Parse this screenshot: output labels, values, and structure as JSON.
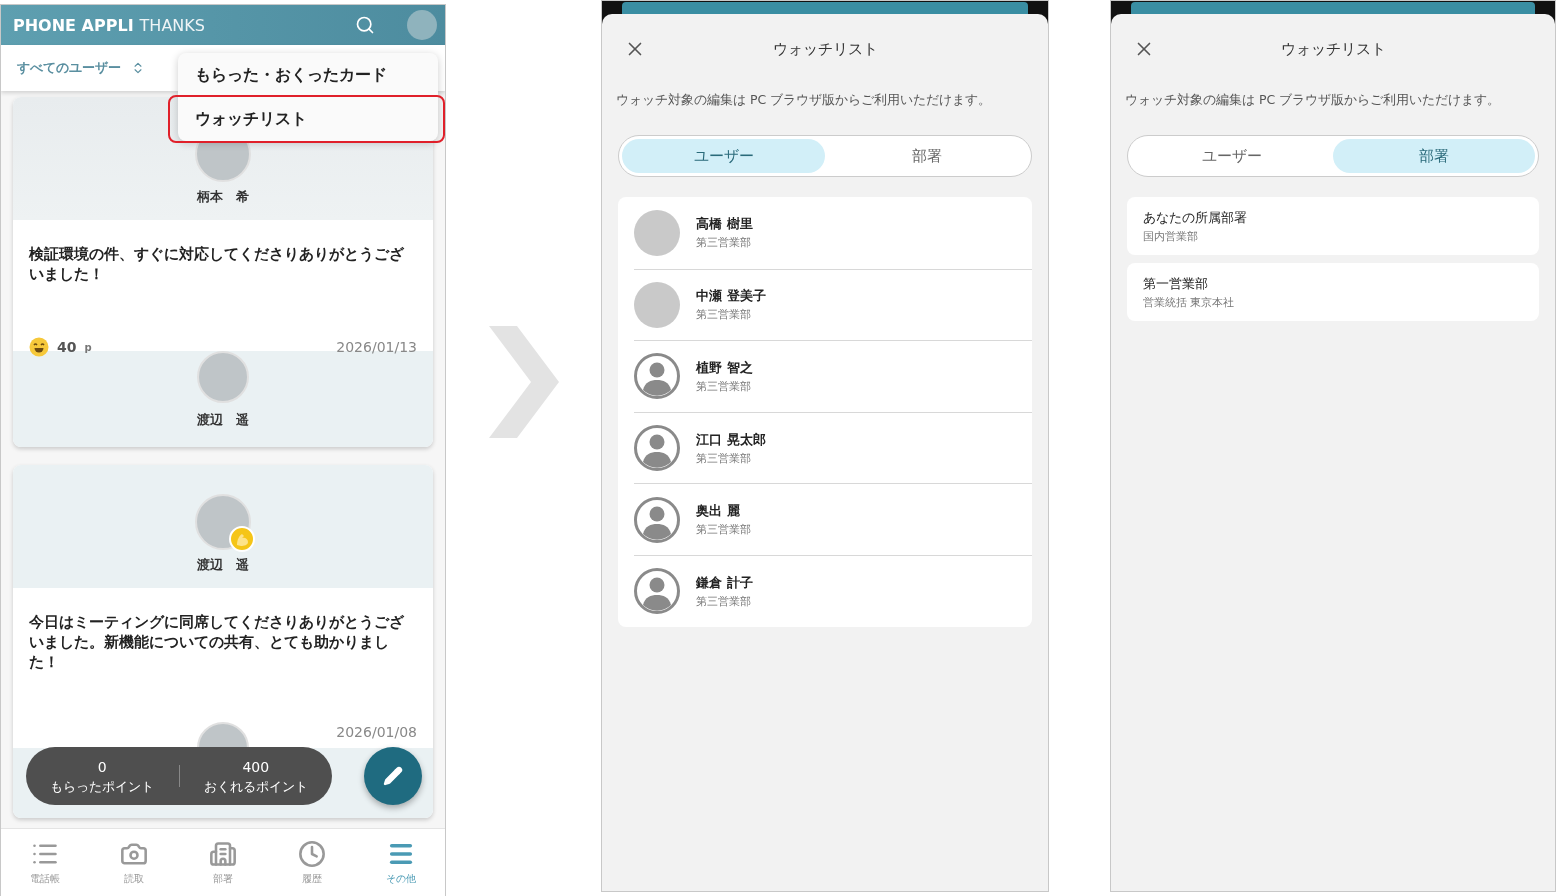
{
  "home": {
    "logo_bold": "PHONE APPLI",
    "logo_light": "THANKS",
    "filter": "すべてのユーザー",
    "menu": [
      {
        "label": "もらった・おくったカード",
        "selected": false
      },
      {
        "label": "ウォッチリスト",
        "selected": true
      }
    ],
    "cards": [
      {
        "sender": "柄本　希",
        "sender_badge": false,
        "message": "検証環境の件、すぐに対応してくださりありがとうございました！",
        "points": "40",
        "points_unit": "p",
        "date": "2026/01/13",
        "recipient": "渡辺　遥"
      },
      {
        "sender": "渡辺　遥",
        "sender_badge": true,
        "message": "今日はミーティングに同席してくださりありがとうございました。新機能についての共有、とても助かりました！",
        "date": "2026/01/08"
      }
    ],
    "points": [
      {
        "value": "0",
        "label": "もらったポイント"
      },
      {
        "value": "400",
        "label": "おくれるポイント"
      }
    ],
    "nav": [
      {
        "kind": "list",
        "label": "電話帳",
        "selected": false
      },
      {
        "kind": "camera",
        "label": "読取",
        "selected": false
      },
      {
        "kind": "building",
        "label": "部署",
        "selected": false
      },
      {
        "kind": "clock",
        "label": "履歴",
        "selected": false
      },
      {
        "kind": "menu",
        "label": "その他",
        "selected": true
      }
    ]
  },
  "watchlists": [
    {
      "title": "ウォッチリスト",
      "notice": "ウォッチ対象の編集は PC ブラウザ版からご利用いただけます。",
      "tabs": [
        {
          "label": "ユーザー",
          "selected": true
        },
        {
          "label": "部署",
          "selected": false
        }
      ],
      "items": [
        {
          "kind": "user",
          "name": "高橋 樹里",
          "sub": "第三営業部",
          "photo": true
        },
        {
          "kind": "user",
          "name": "中瀬 登美子",
          "sub": "第三営業部",
          "photo": true
        },
        {
          "kind": "user",
          "name": "植野 智之",
          "sub": "第三営業部",
          "photo": false
        },
        {
          "kind": "user",
          "name": "江口 晃太郎",
          "sub": "第三営業部",
          "photo": false
        },
        {
          "kind": "user",
          "name": "奥出 麗",
          "sub": "第三営業部",
          "photo": false
        },
        {
          "kind": "user",
          "name": "鎌倉 計子",
          "sub": "第三営業部",
          "photo": false
        }
      ]
    },
    {
      "title": "ウォッチリスト",
      "notice": "ウォッチ対象の編集は PC ブラウザ版からご利用いただけます。",
      "tabs": [
        {
          "label": "ユーザー",
          "selected": false
        },
        {
          "label": "部署",
          "selected": true
        }
      ],
      "items": [
        {
          "kind": "department",
          "name": "あなたの所属部署",
          "sub": "国内営業部"
        },
        {
          "kind": "department",
          "name": "第一営業部",
          "sub": "営業統括 東京本社"
        }
      ]
    }
  ]
}
